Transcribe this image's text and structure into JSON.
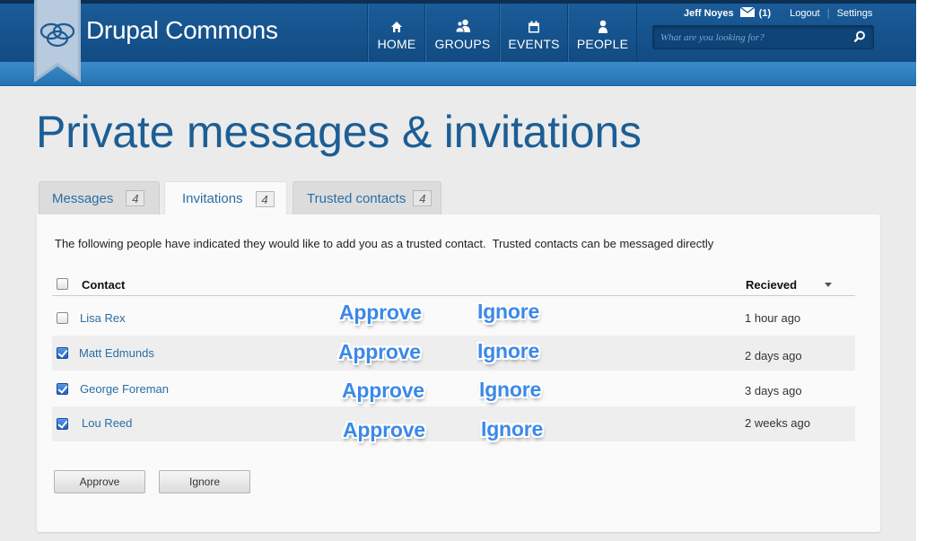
{
  "header": {
    "brand": "Drupal Commons",
    "nav": [
      {
        "label": "HOME",
        "icon": "home-icon"
      },
      {
        "label": "GROUPS",
        "icon": "groups-icon"
      },
      {
        "label": "EVENTS",
        "icon": "calendar-icon"
      },
      {
        "label": "PEOPLE",
        "icon": "person-icon"
      }
    ],
    "user": {
      "name": "Jeff Noyes",
      "message_count": "(1)",
      "logout": "Logout",
      "settings": "Settings"
    },
    "search": {
      "placeholder": "What are you looking for?",
      "value": ""
    }
  },
  "main": {
    "title": "Private messages & invitations",
    "tabs": [
      {
        "label": "Messages",
        "count": "4",
        "active": false
      },
      {
        "label": "Invitations",
        "count": "4",
        "active": true
      },
      {
        "label": "Trusted contacts",
        "count": "4",
        "active": false
      }
    ],
    "intro": "The following people have indicated they would like to add you as a trusted contact.  Trusted contacts can be messaged directly",
    "table": {
      "columns": {
        "contact": "Contact",
        "received": "Recieved"
      },
      "rows": [
        {
          "name": "Lisa Rex",
          "received": "1 hour ago",
          "checked": false
        },
        {
          "name": "Matt Edmunds",
          "received": "2 days ago",
          "checked": true
        },
        {
          "name": "George Foreman",
          "received": "3 days ago",
          "checked": true
        },
        {
          "name": "Lou Reed",
          "received": "2 weeks ago",
          "checked": true
        }
      ]
    },
    "annotations": {
      "approve": "Approve",
      "ignore": "Ignore"
    },
    "buttons": {
      "approve": "Approve",
      "ignore": "Ignore"
    }
  },
  "colors": {
    "header": "#14548f",
    "subbar": "#2a7bbd",
    "title": "#1c5e95",
    "link": "#2a6ea5",
    "annotation": "#3b89e8"
  }
}
